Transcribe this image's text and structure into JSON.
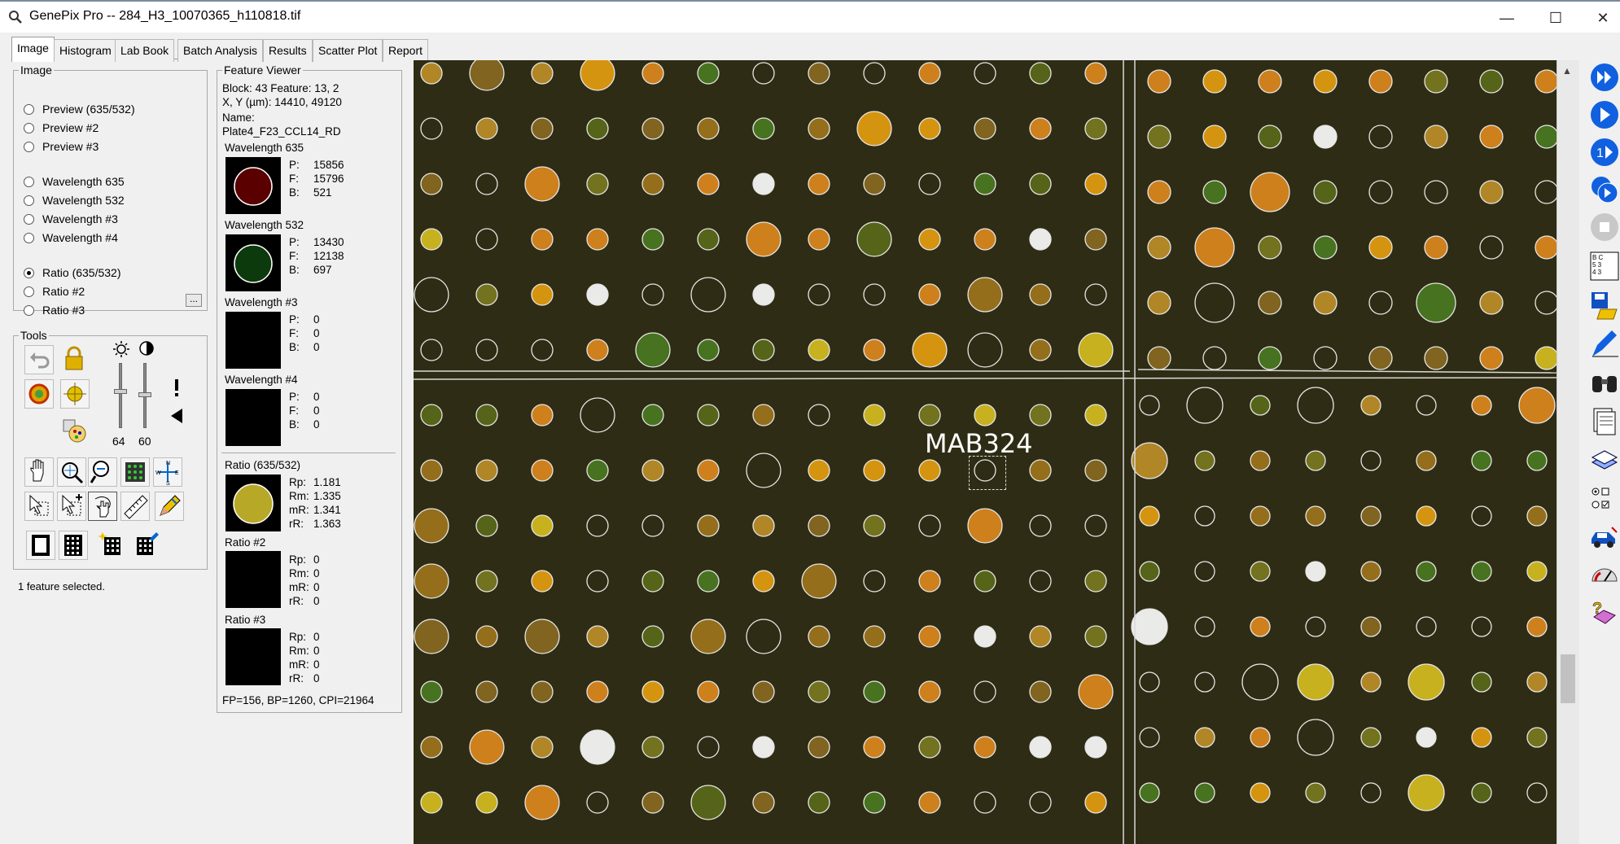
{
  "window": {
    "title": "GenePix Pro -- 284_H3_10070365_h110818.tif",
    "min_glyph": "—",
    "max_glyph": "☐",
    "close_glyph": "✕"
  },
  "tabs": [
    "Image",
    "Histogram",
    "Lab Book",
    "Batch Analysis",
    "Results",
    "Scatter Plot",
    "Report"
  ],
  "image_group": {
    "legend": "Image",
    "options": [
      {
        "label": "Preview (635/532)",
        "selected": false
      },
      {
        "label": "Preview #2",
        "selected": false
      },
      {
        "label": "Preview #3",
        "selected": false
      },
      {
        "label": "Wavelength 635",
        "selected": false
      },
      {
        "label": "Wavelength 532",
        "selected": false
      },
      {
        "label": "Wavelength #3",
        "selected": false
      },
      {
        "label": "Wavelength #4",
        "selected": false
      },
      {
        "label": "Ratio (635/532)",
        "selected": true
      },
      {
        "label": "Ratio #2",
        "selected": false
      },
      {
        "label": "Ratio #3",
        "selected": false
      }
    ],
    "ellipsis": "..."
  },
  "tools": {
    "legend": "Tools",
    "brightness": "64",
    "contrast": "60"
  },
  "status": "1 feature selected.",
  "feature_viewer": {
    "legend": "Feature Viewer",
    "block_line": "Block: 43      Feature:  13, 2",
    "xy_line": "X, Y (µm): 14410, 49120",
    "name_label": "Name:",
    "name_value": "Plate4_F23_CCL14_RD",
    "w635": {
      "title": "Wavelength 635",
      "p": "15856",
      "f": "15796",
      "b": "521"
    },
    "w532": {
      "title": "Wavelength 532",
      "p": "13430",
      "f": "12138",
      "b": "697"
    },
    "w3": {
      "title": "Wavelength #3",
      "p": "0",
      "f": "0",
      "b": "0"
    },
    "w4": {
      "title": "Wavelength #4",
      "p": "0",
      "f": "0",
      "b": "0"
    },
    "ratio1": {
      "title": "Ratio (635/532)",
      "rp": "1.181",
      "rm": "1.335",
      "mr": "1.341",
      "rr": "1.363"
    },
    "ratio2": {
      "title": "Ratio #2",
      "rp": "0",
      "rm": "0",
      "mr": "0",
      "rr": "0"
    },
    "ratio3": {
      "title": "Ratio #3",
      "rp": "0",
      "rm": "0",
      "mr": "0",
      "rr": "0"
    },
    "keys": {
      "p": "P:",
      "f": "F:",
      "b": "B:",
      "rp": "Rp:",
      "rm": "Rm:",
      "mr": "mR:",
      "rr": "rR:"
    },
    "footer": "FP=156, BP=1260, CPI=21964"
  },
  "image_overlay": {
    "annotation": "MAB324"
  },
  "colors": {
    "background": "#2e2c14",
    "grid_line": "#d9d9d9",
    "spot_orange": "#e08a1e",
    "spot_yellow": "#d8c020",
    "spot_green": "#4a7a20",
    "right_tool_blue": "#1060e0"
  },
  "icons": {
    "titlebar": "magnifier-icon",
    "right_toolbar": [
      "fast-forward-icon",
      "play-icon",
      "step-one-icon",
      "batch-icon",
      "stop-icon",
      "grid-block-icon",
      "save-open-icon",
      "pen-icon",
      "binoculars-icon",
      "report-icon",
      "layers-icon",
      "checkbox-options-icon",
      "car-icon",
      "gauge-icon",
      "help-icon"
    ]
  }
}
